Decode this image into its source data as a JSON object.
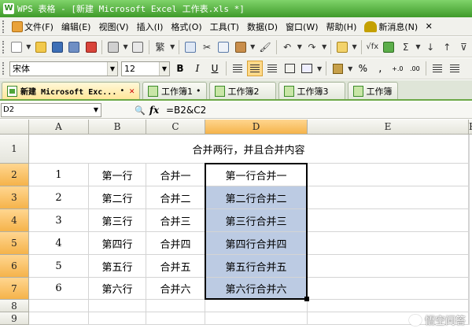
{
  "window": {
    "app_icon": "W",
    "title": "WPS 表格 - [新建 Microsoft Excel 工作表.xls *]"
  },
  "menu": {
    "items": [
      "文件(F)",
      "编辑(E)",
      "视图(V)",
      "插入(I)",
      "格式(O)",
      "工具(T)",
      "数据(D)",
      "窗口(W)",
      "帮助(H)"
    ],
    "news": "新消息(N)",
    "close": "✕"
  },
  "toolbar": {
    "font_name": "宋体",
    "font_size": "12",
    "bold": "B",
    "italic": "I",
    "underline": "U",
    "percent": "%",
    "sum": "Σ"
  },
  "tabs": [
    {
      "label": "新建 Microsoft Exc...",
      "marker": "•",
      "close": "✕",
      "active": true
    },
    {
      "label": "工作簿1",
      "marker": "•",
      "active": false
    },
    {
      "label": "工作簿2",
      "active": false
    },
    {
      "label": "工作簿3",
      "active": false
    },
    {
      "label": "工作簿",
      "active": false
    }
  ],
  "formula": {
    "cell_ref": "D2",
    "fx": "fx",
    "value": "=B2&C2"
  },
  "sheet": {
    "columns": [
      "A",
      "B",
      "C",
      "D",
      "E",
      "F"
    ],
    "rows": [
      "1",
      "2",
      "3",
      "4",
      "5",
      "6",
      "7",
      "8",
      "9"
    ],
    "merged_title": "合并两行，并且合并内容",
    "data": [
      [
        "1",
        "第一行",
        "合并一",
        "第一行合并一"
      ],
      [
        "2",
        "第二行",
        "合并二",
        "第二行合并二"
      ],
      [
        "3",
        "第三行",
        "合并三",
        "第三行合并三"
      ],
      [
        "4",
        "第四行",
        "合并四",
        "第四行合并四"
      ],
      [
        "5",
        "第五行",
        "合并五",
        "第五行合并五"
      ],
      [
        "6",
        "第六行",
        "合并六",
        "第六行合并六"
      ]
    ],
    "selected_column": "D",
    "selected_rows": [
      "2",
      "3",
      "4",
      "5",
      "6",
      "7"
    ]
  },
  "watermark": "悟空问答",
  "colors": {
    "title_green": "#3f9a2a",
    "selection_fill": "#bccbe3",
    "header_selected": "#f5b34a"
  }
}
